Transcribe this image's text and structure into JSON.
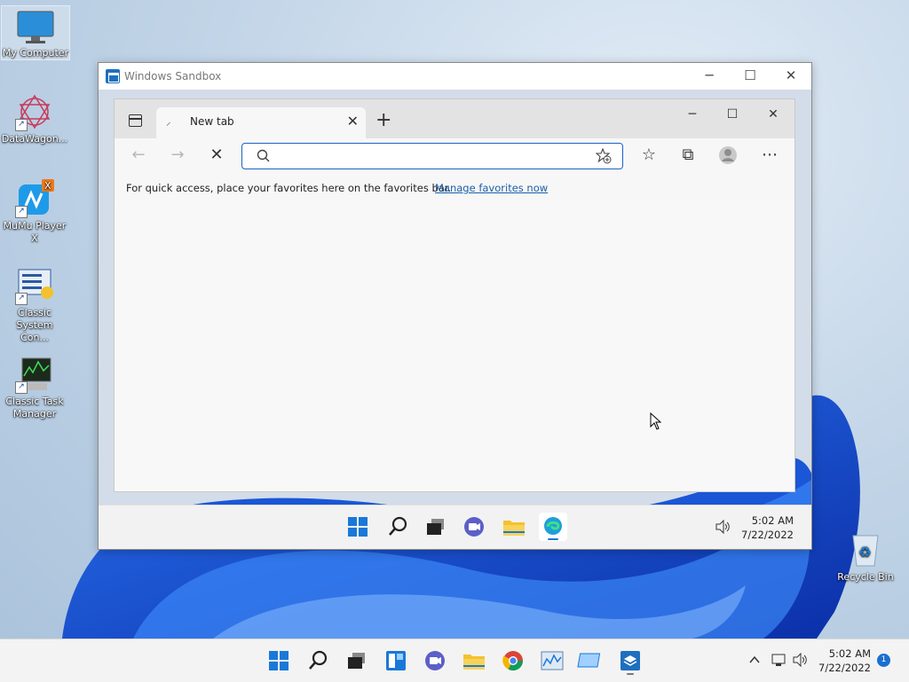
{
  "desktop": {
    "icons": [
      {
        "label": "My Computer"
      },
      {
        "label": "DataWagon..."
      },
      {
        "label": "MuMu Player X"
      },
      {
        "label": "Classic System Con..."
      },
      {
        "label": "Classic Task Manager"
      },
      {
        "label": "Recycle Bin"
      }
    ]
  },
  "sandbox": {
    "title": "Windows Sandbox",
    "minimize_glyph": "─",
    "maximize_glyph": "☐",
    "close_glyph": "✕",
    "taskbar": {
      "time": "5:02 AM",
      "date": "7/22/2022"
    }
  },
  "edge": {
    "tab": {
      "label": "New tab",
      "loading_glyph": "⸝",
      "close_glyph": "✕"
    },
    "new_tab_glyph": "+",
    "minimize_glyph": "─",
    "maximize_glyph": "☐",
    "close_glyph": "✕",
    "address": {
      "value": "",
      "placeholder": ""
    },
    "favorites_bar": {
      "text": "For quick access, place your favorites here on the favorites bar.",
      "link": "Manage favorites now"
    }
  },
  "taskbar": {
    "time": "5:02 AM",
    "date": "7/22/2022",
    "notification_count": "1"
  },
  "colors": {
    "accent": "#1b63c6",
    "bloom": "#1a56d6",
    "taskbar": "#f3f3f3"
  }
}
